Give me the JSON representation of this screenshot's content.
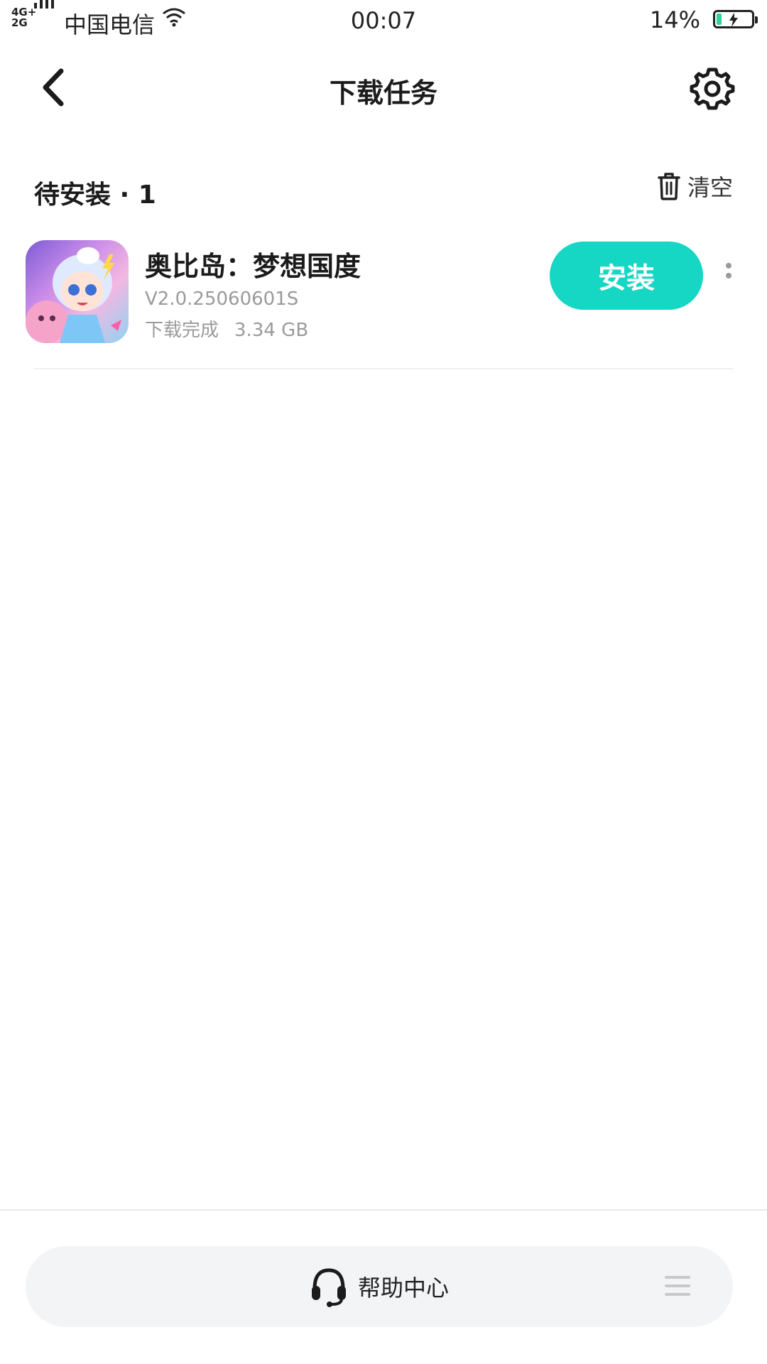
{
  "status_bar": {
    "network_top": "4G+",
    "network_bottom": "2G",
    "carrier": "中国电信",
    "time": "00:07",
    "battery_percent": "14%",
    "battery_level": 0.14,
    "battery_color": "#2fd29a"
  },
  "header": {
    "title": "下载任务",
    "back_icon": "chevron-left-icon",
    "settings_icon": "gear-icon"
  },
  "section": {
    "title": "待安装 · 1",
    "clear_label": "清空",
    "clear_icon": "trash-icon"
  },
  "task": {
    "app_name": "奥比岛：梦想国度",
    "version": "V2.0.25060601S",
    "status": "下载完成",
    "size": "3.34 GB",
    "install_label": "安装",
    "install_color": "#16d6c4",
    "more_icon": "more-vertical-icon"
  },
  "bottom": {
    "help_label": "帮助中心",
    "help_icon": "headset-icon",
    "menu_icon": "menu-icon"
  }
}
